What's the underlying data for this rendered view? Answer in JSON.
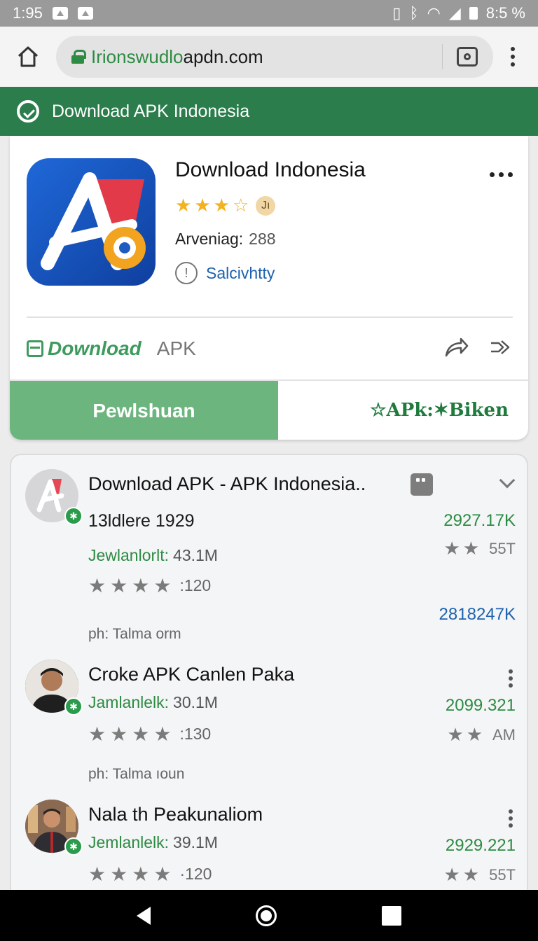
{
  "status_bar": {
    "time": "1:95",
    "battery": "8:5 %"
  },
  "browser": {
    "url_host": "Irionswudlo",
    "url_rest": "apdn.com"
  },
  "site_header": {
    "title": "Download APK Indonesia"
  },
  "app_card": {
    "title": "Download Indonesia",
    "rating_badge": "Jı",
    "meta_label": "Arveniag:",
    "meta_value": "288",
    "link_text": "Salcivhtty",
    "download_label": "Download",
    "apk_label": "APK",
    "primary_button": "Pewlshuan",
    "secondary_button": "☆APk:✶Biken"
  },
  "list": {
    "items": [
      {
        "title": "Download APK - APK Indonesia..",
        "subtitle": "13ldlere 1929",
        "downloads_label": "Jewlanlorlt:",
        "downloads_value": "43.1M",
        "stars_count": ":120",
        "footer": "ph: Talma orm",
        "right_value_1": "2927.17K",
        "right_stars_text": "55T",
        "right_value_2": "2818247K"
      },
      {
        "title": "Croke APK Canlen Paka",
        "downloads_label": "Jamlanlelk:",
        "downloads_value": "30.1M",
        "stars_count": ":130",
        "footer": "ph: Talma ıoun",
        "right_value_1": "2099.321",
        "right_stars_text": "AM"
      },
      {
        "title": "Nala th Peakunaliom",
        "downloads_label": "Jemlanlelk:",
        "downloads_value": "39.1M",
        "stars_count": "·120",
        "right_value_1": "2929.221",
        "right_stars_text": "55T"
      }
    ]
  },
  "colors": {
    "brand_green": "#2b7d4c",
    "button_green": "#6cb57e",
    "link_blue": "#1e62b0",
    "star_gold": "#f3b21f"
  }
}
